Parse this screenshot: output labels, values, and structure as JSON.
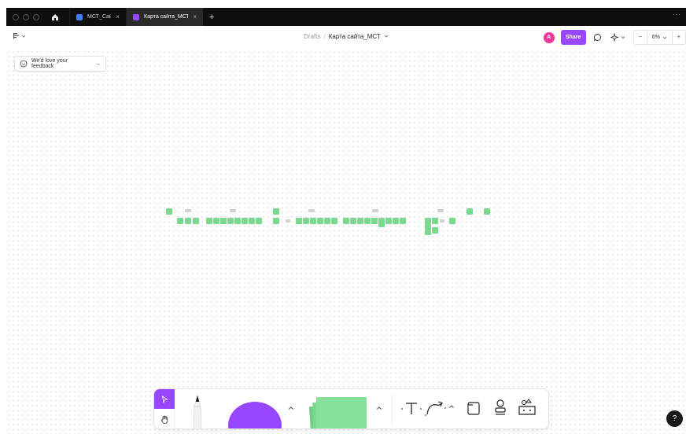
{
  "window": {
    "tabs": [
      {
        "label": "МСТ_Сайт",
        "active": false,
        "icon_color": "#3b82f6"
      },
      {
        "label": "Карта сайта_МСТ",
        "active": true,
        "icon_color": "#9747ff"
      }
    ],
    "close_glyph": "×",
    "new_tab_glyph": "+",
    "more_glyph": "···"
  },
  "toolbar": {
    "breadcrumb_parent": "Drafts",
    "breadcrumb_separator": "/",
    "file_name": "Карта сайта_МСТ",
    "avatar_initial": "A",
    "share_label": "Share",
    "zoom_level": "6%",
    "zoom_out": "−",
    "zoom_in": "+"
  },
  "canvas": {
    "feedback_label": "We'd love your feedback",
    "feedback_arrow": "→",
    "sticky_color": "#7bd88f"
  },
  "bottom_tools": {
    "items": [
      "move-tool",
      "hand-tool",
      "marker-tool",
      "shape-tool",
      "sticky-note-tool",
      "text-tool",
      "connector-tool",
      "section-tool",
      "stamp-tool",
      "more-tools"
    ]
  },
  "help_label": "?",
  "colors": {
    "accent": "#9747ff",
    "avatar": "#f2369b",
    "sticky": "#7bd88f"
  }
}
